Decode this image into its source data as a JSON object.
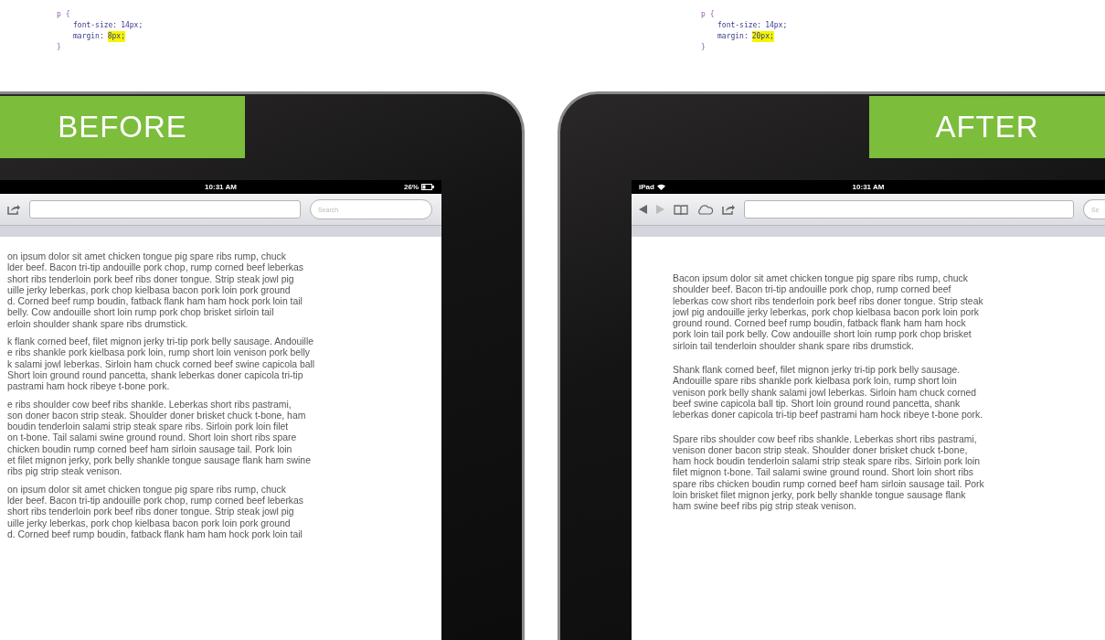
{
  "panels": [
    {
      "code": {
        "selector": "p {",
        "declarations": [
          {
            "property": "font-size:",
            "value": "14px;",
            "highlighted": false
          },
          {
            "property": "margin:",
            "value": "8px;",
            "highlighted": true
          }
        ],
        "close": "}"
      },
      "label": "BEFORE",
      "kind": "left",
      "status": {
        "time": "10:31 AM",
        "battery": "26%"
      },
      "toolbar": {
        "nav": false,
        "search_placeholder": "Search"
      },
      "paragraphs": [
        {
          "lines": [
            "on ipsum dolor sit amet chicken tongue pig spare ribs rump, chuck",
            "lder beef. Bacon tri-tip andouille pork chop, rump corned beef leberkas",
            "short ribs tenderloin pork beef ribs doner tongue. Strip steak jowl pig",
            "uille jerky leberkas, pork chop kielbasa bacon pork loin pork ground",
            "d. Corned beef rump boudin, fatback flank ham ham hock pork loin tail",
            "belly. Cow andouille short loin rump pork chop brisket sirloin tail",
            "erloin shoulder shank spare ribs drumstick."
          ]
        },
        {
          "lines": [
            "k flank corned beef, filet mignon jerky tri-tip pork belly sausage. Andouille",
            "e ribs shankle pork kielbasa pork loin, rump short loin venison pork belly",
            "k salami jowl leberkas. Sirloin ham chuck corned beef swine capicola ball",
            "Short loin ground round pancetta, shank leberkas doner capicola tri-tip",
            "pastrami ham hock ribeye t-bone pork."
          ]
        },
        {
          "lines": [
            "e ribs shoulder cow beef ribs shankle. Leberkas short ribs pastrami,",
            "son doner bacon strip steak. Shoulder doner brisket chuck t-bone, ham",
            "boudin tenderloin salami strip steak spare ribs. Sirloin pork loin filet",
            "on t-bone. Tail salami swine ground round. Short loin short ribs spare",
            "chicken boudin rump corned beef ham sirloin sausage tail. Pork loin",
            "et filet mignon jerky, pork belly shankle tongue sausage flank ham swine",
            "ribs pig strip steak venison."
          ]
        },
        {
          "lines": [
            "on ipsum dolor sit amet chicken tongue pig spare ribs rump, chuck",
            "lder beef. Bacon tri-tip andouille pork chop, rump corned beef leberkas",
            "short ribs tenderloin pork beef ribs doner tongue. Strip steak jowl pig",
            "uille jerky leberkas, pork chop kielbasa bacon pork loin pork ground",
            "d. Corned beef rump boudin, fatback flank ham ham hock pork loin tail"
          ]
        }
      ]
    },
    {
      "code": {
        "selector": "p {",
        "declarations": [
          {
            "property": "font-size:",
            "value": "14px;",
            "highlighted": false
          },
          {
            "property": "margin:",
            "value": "20px;",
            "highlighted": true
          }
        ],
        "close": "}"
      },
      "label": "AFTER",
      "kind": "right",
      "status": {
        "carrier": "iPad",
        "time": "10:31 AM"
      },
      "toolbar": {
        "nav": true,
        "search_placeholder": "Se"
      },
      "paragraphs": [
        {
          "lines": [
            "Bacon ipsum dolor sit amet chicken tongue pig spare ribs rump, chuck",
            "shoulder beef. Bacon tri-tip andouille pork chop, rump corned beef",
            "leberkas cow short ribs tenderloin pork beef ribs doner tongue. Strip steak",
            "jowl pig andouille jerky leberkas, pork chop kielbasa bacon pork loin pork",
            "ground round. Corned beef rump boudin, fatback flank ham ham hock",
            "pork loin tail pork belly. Cow andouille short loin rump pork chop brisket",
            "sirloin tail tenderloin shoulder shank spare ribs drumstick."
          ]
        },
        {
          "lines": [
            "Shank flank corned beef, filet mignon jerky tri-tip pork belly sausage.",
            "Andouille spare ribs shankle pork kielbasa pork loin, rump short loin",
            "venison pork belly shank salami jowl leberkas. Sirloin ham chuck corned",
            "beef swine capicola ball tip. Short loin ground round pancetta, shank",
            "leberkas doner capicola tri-tip beef pastrami ham hock ribeye t-bone pork."
          ]
        },
        {
          "lines": [
            "Spare ribs shoulder cow beef ribs shankle. Leberkas short ribs pastrami,",
            "venison doner bacon strip steak. Shoulder doner brisket chuck t-bone,",
            "ham hock boudin tenderloin salami strip steak spare ribs. Sirloin pork loin",
            "filet mignon t-bone. Tail salami swine ground round. Short loin short ribs",
            "spare ribs chicken boudin rump corned beef ham sirloin sausage tail. Pork",
            "loin brisket filet mignon jerky, pork belly shankle tongue sausage flank",
            "ham swine beef ribs pig strip steak venison."
          ]
        }
      ]
    }
  ]
}
